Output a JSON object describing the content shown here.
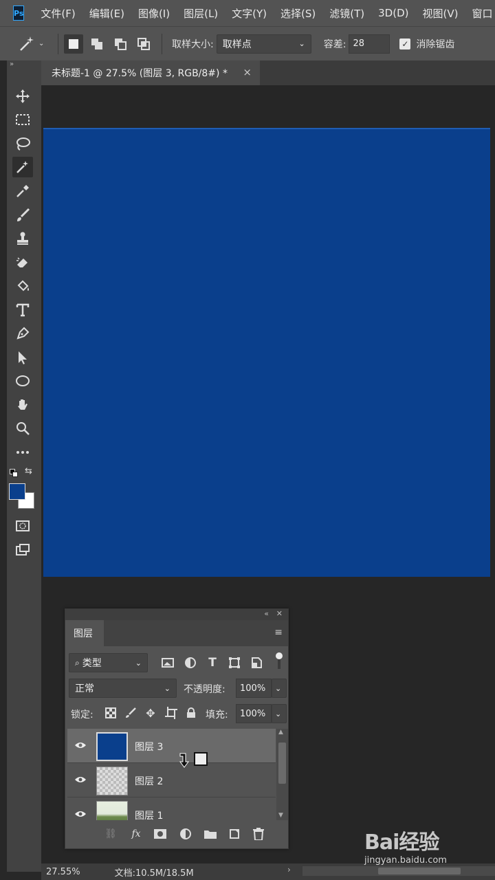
{
  "app": {
    "logo_text": "Ps"
  },
  "menu": [
    "文件(F)",
    "编辑(E)",
    "图像(I)",
    "图层(L)",
    "文字(Y)",
    "选择(S)",
    "滤镜(T)",
    "3D(D)",
    "视图(V)",
    "窗口"
  ],
  "options": {
    "sample_size_label": "取样大小:",
    "sample_size_value": "取样点",
    "tolerance_label": "容差:",
    "tolerance_value": "28",
    "antialias_label": "消除锯齿",
    "antialias_checked": true
  },
  "document": {
    "tab_title": "未标题-1 @ 27.5% (图层 3, RGB/8#) *",
    "close_glyph": "×",
    "canvas_color": "#0a3f8c"
  },
  "toolbar": {
    "tools": [
      "move-tool",
      "marquee-tool",
      "lasso-tool",
      "magic-wand-tool",
      "eyedropper-tool",
      "brush-tool",
      "stamp-tool",
      "eraser-tool",
      "paint-bucket-tool",
      "type-tool",
      "pen-tool",
      "path-selection-tool",
      "ellipse-tool",
      "hand-tool",
      "zoom-tool",
      "more-tools"
    ],
    "active_tool": "magic-wand-tool",
    "foreground_color": "#0a3f8c",
    "background_color": "#ffffff"
  },
  "layers_panel": {
    "tab_label": "图层",
    "filter_label": "类型",
    "blend_mode": "正常",
    "opacity_label": "不透明度:",
    "opacity_value": "100%",
    "lock_label": "锁定:",
    "fill_label": "填充:",
    "fill_value": "100%",
    "layers": [
      {
        "name": "图层 3",
        "selected": true
      },
      {
        "name": "图层 2",
        "selected": false
      },
      {
        "name": "图层 1",
        "selected": false
      }
    ]
  },
  "status": {
    "zoom": "27.55%",
    "doc_size": "文档:10.5M/18.5M"
  },
  "watermark": {
    "logo": "Bai经验",
    "url": "jingyan.baidu.com"
  }
}
